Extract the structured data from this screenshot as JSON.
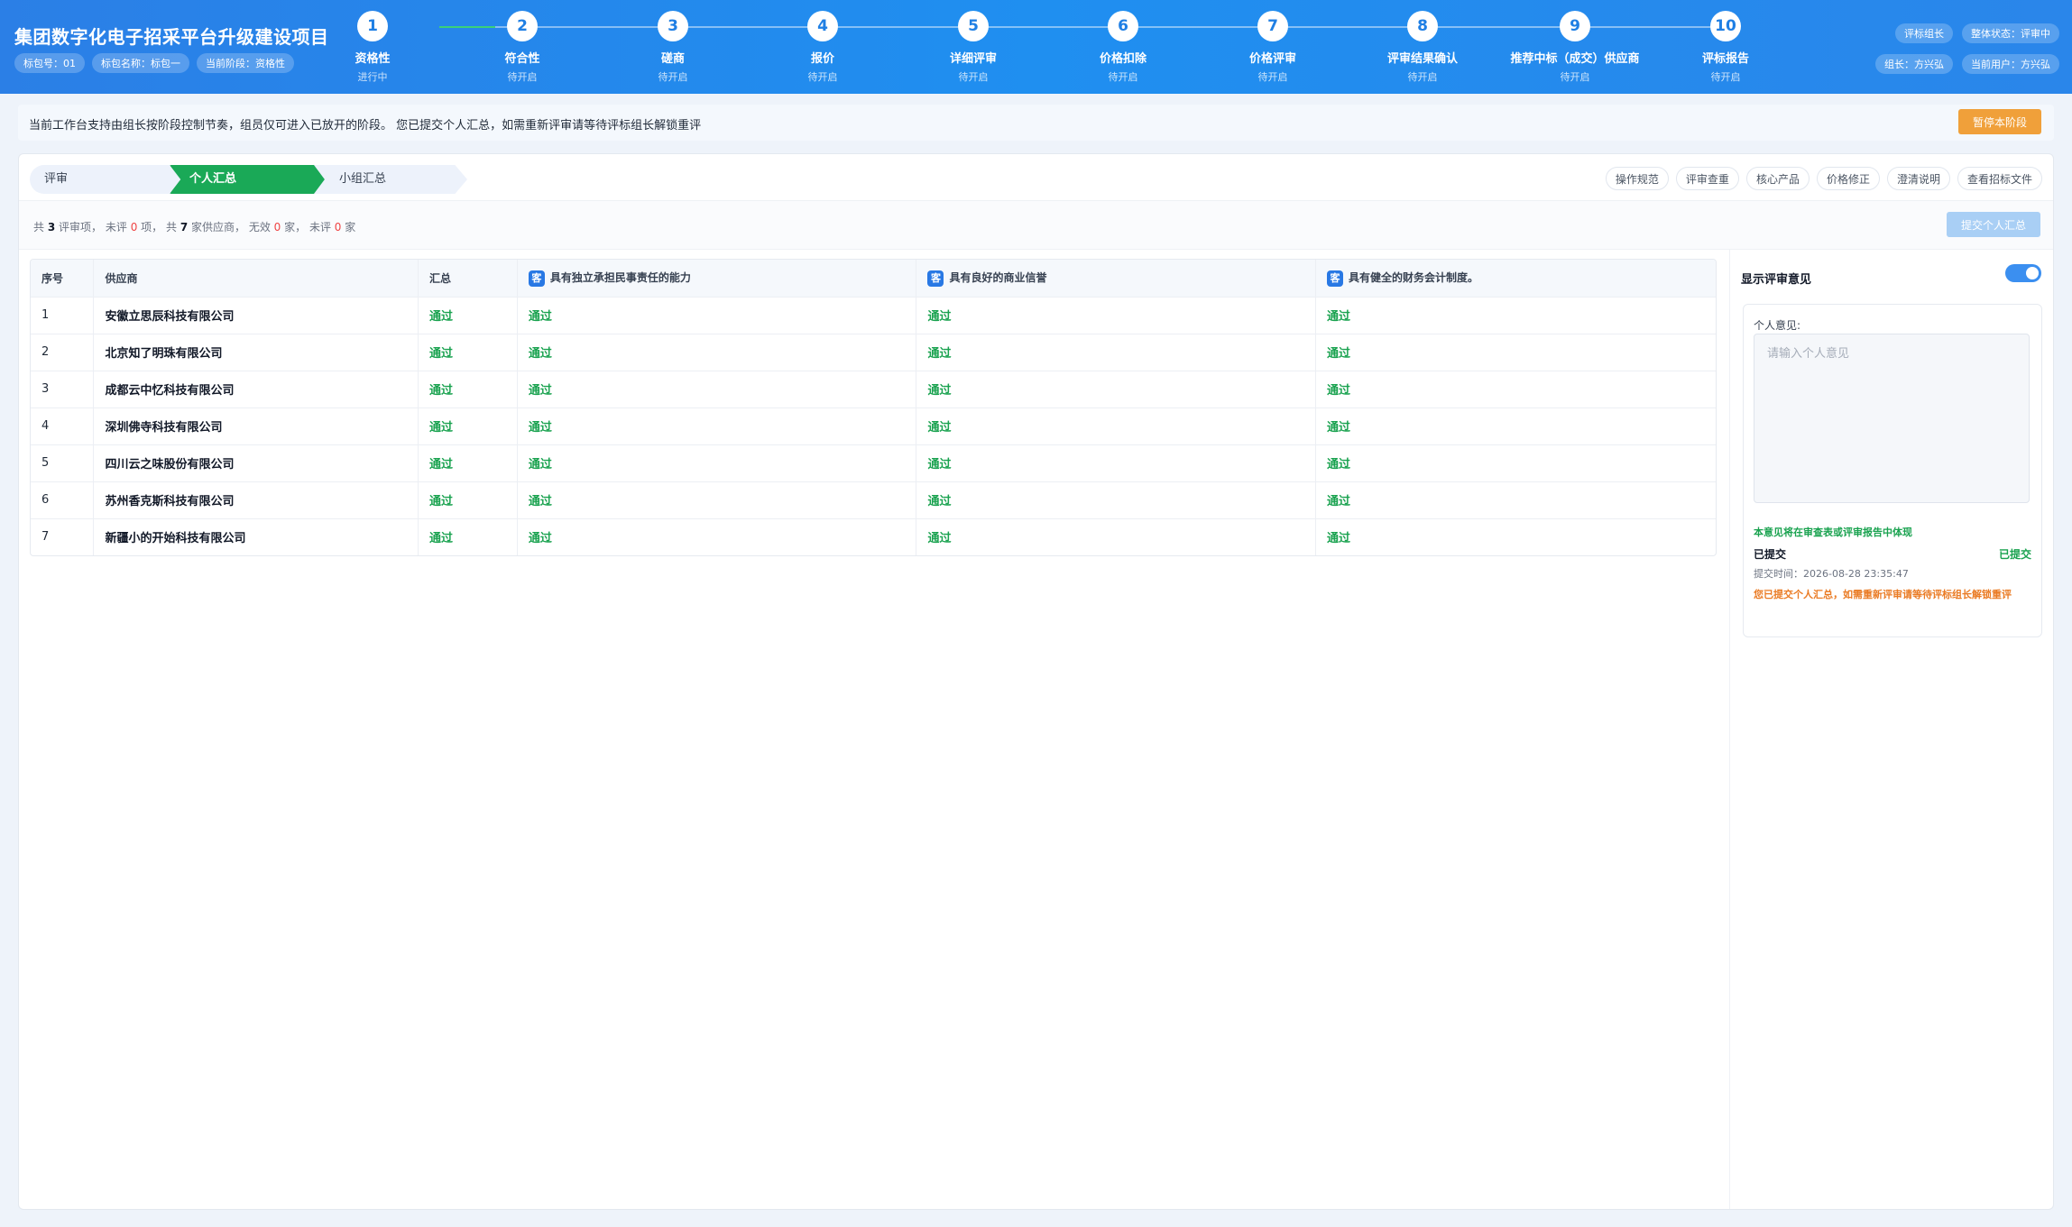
{
  "header": {
    "title": "集团数字化电子招采平台升级建设项目",
    "tags": [
      "标包号：01",
      "标包名称：标包一",
      "当前阶段：资格性"
    ],
    "right_row1": [
      "评标组长",
      "整体状态：评审中"
    ],
    "right_row2": [
      "组长：方兴弘",
      "当前用户：方兴弘"
    ]
  },
  "steps": [
    {
      "num": "1",
      "label": "资格性",
      "status": "进行中"
    },
    {
      "num": "2",
      "label": "符合性",
      "status": "待开启"
    },
    {
      "num": "3",
      "label": "磋商",
      "status": "待开启"
    },
    {
      "num": "4",
      "label": "报价",
      "status": "待开启"
    },
    {
      "num": "5",
      "label": "详细评审",
      "status": "待开启"
    },
    {
      "num": "6",
      "label": "价格扣除",
      "status": "待开启"
    },
    {
      "num": "7",
      "label": "价格评审",
      "status": "待开启"
    },
    {
      "num": "8",
      "label": "评审结果确认",
      "status": "待开启"
    },
    {
      "num": "9",
      "label": "推荐中标（成交）供应商",
      "status": "待开启"
    },
    {
      "num": "10",
      "label": "评标报告",
      "status": "待开启"
    }
  ],
  "notice": {
    "text": "当前工作台支持由组长按阶段控制节奏，组员仅可进入已放开的阶段。 您已提交个人汇总，如需重新评审请等待评标组长解锁重评",
    "pause_label": "暂停本阶段"
  },
  "stage_tabs": [
    "评审",
    "个人汇总",
    "小组汇总"
  ],
  "tools": [
    "操作规范",
    "评审查重",
    "核心产品",
    "价格修正",
    "澄清说明",
    "查看招标文件"
  ],
  "summary": {
    "p1": "共",
    "items": "3",
    "p2": "评审项，  未评",
    "unreviewed": "0",
    "p3": "项，  共",
    "suppliers": "7",
    "p4": "家供应商，  无效",
    "invalid": "0",
    "p5": "家，  未评",
    "unrev_sup": "0",
    "p6": "家",
    "submit_label": "提交个人汇总"
  },
  "table": {
    "headers": [
      "序号",
      "供应商",
      "汇总",
      "具有独立承担民事责任的能力",
      "具有良好的商业信誉",
      "具有健全的财务会计制度。"
    ],
    "crit_icon": "客",
    "rows": [
      [
        "1",
        "安徽立思辰科技有限公司",
        "通过",
        "通过",
        "通过",
        "通过"
      ],
      [
        "2",
        "北京知了明珠有限公司",
        "通过",
        "通过",
        "通过",
        "通过"
      ],
      [
        "3",
        "成都云中忆科技有限公司",
        "通过",
        "通过",
        "通过",
        "通过"
      ],
      [
        "4",
        "深圳佛寺科技有限公司",
        "通过",
        "通过",
        "通过",
        "通过"
      ],
      [
        "5",
        "四川云之味股份有限公司",
        "通过",
        "通过",
        "通过",
        "通过"
      ],
      [
        "6",
        "苏州香克斯科技有限公司",
        "通过",
        "通过",
        "通过",
        "通过"
      ],
      [
        "7",
        "新疆小的开始科技有限公司",
        "通过",
        "通过",
        "通过",
        "通过"
      ]
    ]
  },
  "side": {
    "title": "显示评审意见",
    "opinion_label": "个人意见:",
    "placeholder": "请输入个人意见",
    "hint": "本意见将在审查表或评审报告中体现",
    "status": "已提交",
    "status_right": "已提交",
    "time": "提交时间：2026-08-28 23:35:47",
    "warning": "您已提交个人汇总，如需重新评审请等待评标组长解锁重评"
  },
  "colors": {
    "primary": "#2b7fe6",
    "success": "#19a24f",
    "warning": "#f0a03a",
    "active_tab": "#1aa957"
  }
}
